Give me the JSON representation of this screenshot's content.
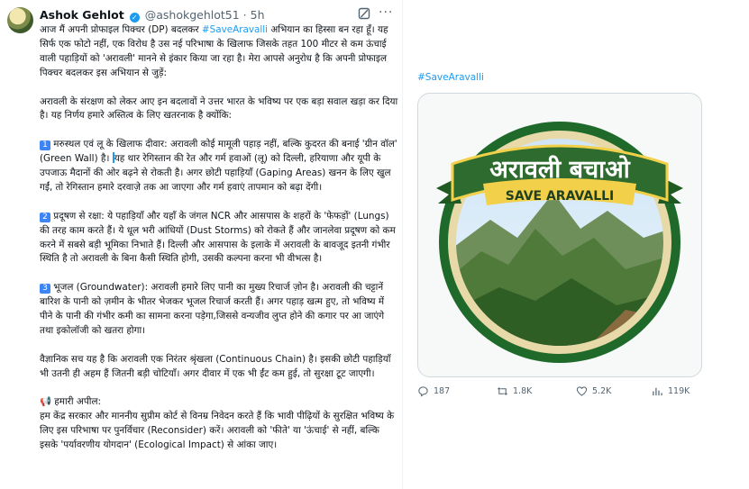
{
  "author": {
    "name": "Ashok Gehlot",
    "handle": "@ashokgehlot51",
    "separator": "·",
    "time": "5h"
  },
  "icons": {
    "verified": "verified-badge-icon",
    "grok": "grok-icon",
    "more": "more-options-icon",
    "reply": "reply-icon",
    "retweet": "retweet-icon",
    "like": "like-icon",
    "views": "views-icon"
  },
  "colors": {
    "link": "#1d9bf0",
    "number_badge": "#3d84f5",
    "banner_green": "#2e6b2e",
    "ribbon_yellow": "#f2d04a"
  },
  "tweet": {
    "intro_a": "आज मैं अपनी प्रोफाइल पिक्चर (DP) बदलकर ",
    "intro_tag": "#SaveAravalli",
    "intro_b": " अभियान का हिस्सा बन रहा हूँ। यह सिर्फ एक फोटो नहीं, एक विरोध है उस नई परिभाषा के खिलाफ जिसके तहत 100 मीटर से कम ऊंचाई वाली पहाड़ियों को 'अरावली' मानने से इंकार किया जा रहा है। मेरा आपसे अनुरोध है कि अपनी प्रोफाइल पिक्चर बदलकर इस अभियान से जुड़ें:",
    "para2": "अरावली के संरक्षण को लेकर आए इन बदलावों ने उत्तर भारत के भविष्य पर एक बड़ा सवाल खड़ा कर दिया है। यह निर्णय हमारे अस्तित्व के लिए खतरनाक है क्योंकि:",
    "p1_num": "1",
    "p1_a": " मरुस्थल एवं लू के खिलाफ दीवार: अरावली कोई मामूली पहाड़ नहीं, बल्कि कुदरत की बनाई 'ग्रीन वॉल' (Green Wall) है। ",
    "p1_b": "यह थार रेगिस्तान की रेत और गर्म हवाओं (लू) को दिल्ली, हरियाणा और यूपी के उपजाऊ मैदानों की ओर बढ़ने से रोकती है। अगर छोटी पहाड़ियाँ (Gaping Areas) खनन के लिए खुल गईं, तो रेगिस्तान हमारे दरवाज़े तक आ जाएगा और गर्म हवाएं तापमान को बढ़ा देंगी।",
    "p2_num": "2",
    "p2": " प्रदूषण से रक्षा: ये पहाड़ियाँ और यहाँ के जंगल NCR और आसपास के शहरों के 'फेफड़ों' (Lungs) की तरह काम करते हैं। ये धूल भरी आंधियों (Dust Storms) को रोकते हैं और जानलेवा प्रदूषण को कम करने में सबसे बड़ी भूमिका निभाते हैं। दिल्ली और आसपास के इलाके में अरावली के बावजूद इतनी गंभीर स्थिति है तो अरावली के बिना कैसी स्थिति होगी, उसकी कल्पना करना भी वीभत्स है।",
    "p3_num": "3",
    "p3": " भूजल (Groundwater): अरावली हमारे लिए पानी का मुख्य रिचार्ज ज़ोन है। अरावली की चट्टानें बारिश के पानी को ज़मीन के भीतर भेजकर भूजल रिचार्ज करती हैं। अगर पहाड़ खत्म हुए, तो भविष्य में पीने के पानी की गंभीर कमी का सामना करना पड़ेगा,जिससे वन्यजीव लुप्त होने की कगार पर आ जाएंगे तथा इकोलॉजी को खतरा होगा।",
    "p4": "वैज्ञानिक सच यह है कि अरावली एक निरंतर श्रृंखला (Continuous Chain) है। इसकी छोटी पहाड़ियाँ भी उतनी ही अहम हैं जितनी बड़ी चोटियाँ। अगर दीवार में एक भी ईंट कम हुई, तो सुरक्षा टूट जाएगी।",
    "appeal_emoji": "📢",
    "appeal_title": " हमारी अपील:",
    "appeal": "हम केंद्र सरकार और माननीय सुप्रीम कोर्ट से विनम्र निवेदन करते हैं कि भावी पीढ़ियों के सुरक्षित भविष्य के लिए इस परिभाषा पर पुनर्विचार (Reconsider) करें। अरावली को 'फीते' या 'ऊंचाई' से नहीं, बल्कि इसके 'पर्यावरणीय योगदान' (Ecological Impact) से आंका जाए।"
  },
  "media": {
    "tag": "#SaveAravalli",
    "banner_hindi": "अरावली बचाओ",
    "banner_english": "SAVE ARAVALLI"
  },
  "stats": {
    "replies": "187",
    "retweets": "1.8K",
    "likes": "5.2K",
    "views": "119K"
  }
}
